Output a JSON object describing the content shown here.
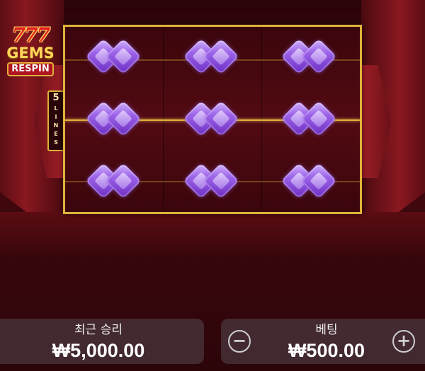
{
  "game": {
    "logo_top": "777",
    "logo_middle": "GEMS",
    "logo_bottom": "RESPIN",
    "lines_count": "5",
    "lines_label": "LINES"
  },
  "reels": {
    "columns": 3,
    "rows": 3,
    "symbols": [
      [
        "purple-gem",
        "purple-gem",
        "purple-gem"
      ],
      [
        "purple-gem",
        "purple-gem",
        "purple-gem"
      ],
      [
        "purple-gem",
        "purple-gem",
        "purple-gem"
      ]
    ]
  },
  "last_win": {
    "label": "최근 승리",
    "value": "₩5,000.00"
  },
  "bet": {
    "label": "베팅",
    "value": "₩500.00",
    "decrease_icon": "minus-icon",
    "increase_icon": "plus-icon"
  },
  "colors": {
    "frame_gold": "#e0b23a",
    "background_red": "#4a0a10",
    "gem_purple": "#9b62e8"
  }
}
